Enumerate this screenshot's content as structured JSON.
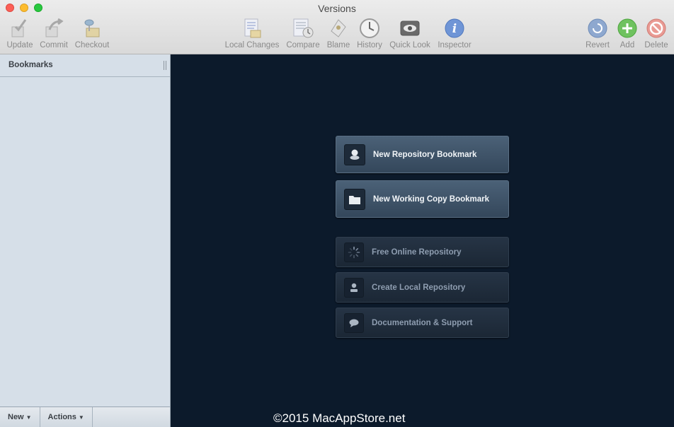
{
  "window": {
    "title": "Versions"
  },
  "toolbar": {
    "left": [
      {
        "label": "Update",
        "icon": "update-icon"
      },
      {
        "label": "Commit",
        "icon": "commit-icon"
      },
      {
        "label": "Checkout",
        "icon": "checkout-icon"
      }
    ],
    "center": [
      {
        "label": "Local Changes",
        "icon": "local-changes-icon"
      },
      {
        "label": "Compare",
        "icon": "compare-icon"
      },
      {
        "label": "Blame",
        "icon": "blame-icon"
      },
      {
        "label": "History",
        "icon": "history-clock-icon"
      },
      {
        "label": "Quick Look",
        "icon": "eye-icon"
      },
      {
        "label": "Inspector",
        "icon": "info-icon"
      }
    ],
    "right": [
      {
        "label": "Revert",
        "icon": "revert-icon"
      },
      {
        "label": "Add",
        "icon": "plus-icon"
      },
      {
        "label": "Delete",
        "icon": "no-entry-icon"
      }
    ]
  },
  "sidebar": {
    "title": "Bookmarks",
    "footer": {
      "new_label": "New",
      "actions_label": "Actions"
    }
  },
  "main": {
    "primary_actions": [
      {
        "label": "New Repository Bookmark",
        "icon": "repository-icon"
      },
      {
        "label": "New Working Copy Bookmark",
        "icon": "folder-icon"
      }
    ],
    "secondary_actions": [
      {
        "label": "Free Online Repository",
        "icon": "loading-spinner-icon"
      },
      {
        "label": "Create Local Repository",
        "icon": "local-repository-icon"
      },
      {
        "label": "Documentation & Support",
        "icon": "speech-bubble-icon"
      }
    ]
  },
  "watermark": "©2015 MacAppStore.net",
  "colors": {
    "sidebar": "#d6dfe8",
    "main_background": "#0c1a2b",
    "primary_button": "#3f5367",
    "secondary_button": "#212e3d"
  }
}
